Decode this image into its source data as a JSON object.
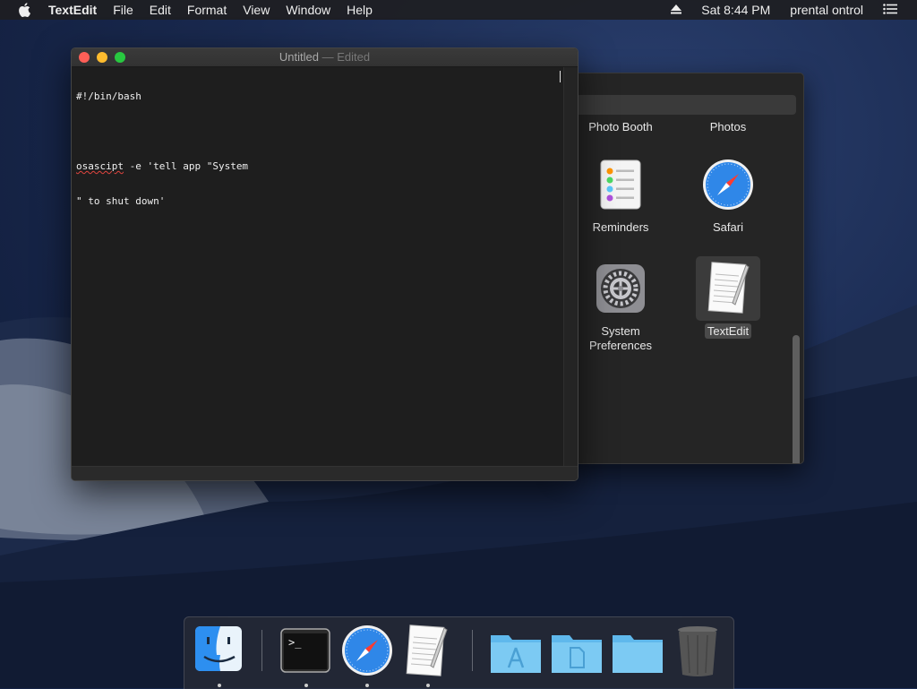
{
  "menubar": {
    "app_name": "TextEdit",
    "items": [
      "File",
      "Edit",
      "Format",
      "View",
      "Window",
      "Help"
    ],
    "clock": "Sat 8:44 PM",
    "user": "prental ontrol"
  },
  "textedit": {
    "title": "Untitled",
    "title_suffix": " — Edited",
    "lines": [
      "#!/bin/bash",
      "",
      "osascipt -e 'tell app \"System",
      "\" to shut down'"
    ],
    "misspelled_word": "osascipt",
    "line3_rest": " -e 'tell app \"System"
  },
  "apps_window": {
    "partial_labels": [
      "Photo Booth",
      "Photos"
    ],
    "apps": [
      {
        "label": "Reminders",
        "icon": "reminders-icon"
      },
      {
        "label": "Safari",
        "icon": "safari-icon"
      },
      {
        "label": "System Preferences",
        "icon": "system-preferences-icon"
      },
      {
        "label": "TextEdit",
        "icon": "textedit-icon",
        "selected": true
      }
    ]
  },
  "dock": {
    "items": [
      "finder-icon",
      "terminal-icon",
      "safari-icon",
      "textedit-icon",
      "applications-folder-icon",
      "documents-folder-icon",
      "downloads-folder-icon",
      "trash-icon"
    ],
    "terminal_prompt": ">_"
  },
  "colors": {
    "close": "#ff5f57",
    "minimize": "#febc2e",
    "maximize": "#28c840"
  }
}
